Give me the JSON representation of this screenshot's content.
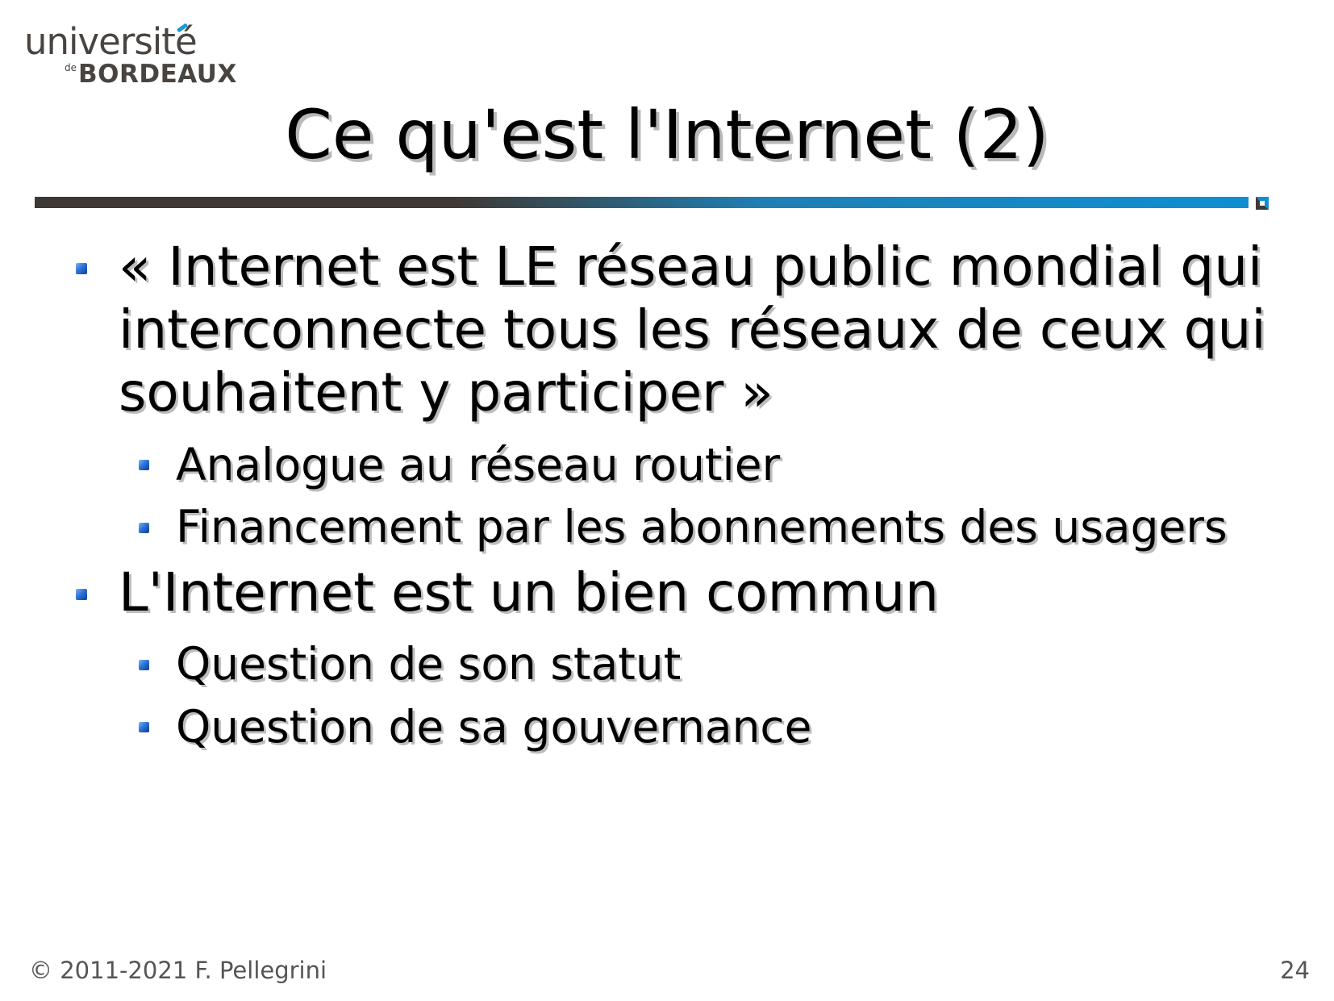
{
  "logo": {
    "line1": "université",
    "line2_small": "de",
    "line2_big": "BORDEAUX"
  },
  "slide": {
    "title": "Ce qu'est l'Internet (2)",
    "bullets": [
      {
        "lines": [
          "« Internet est LE réseau public mondial qui",
          "interconnecte tous les réseaux de ceux qui",
          "souhaitent y participer »"
        ],
        "sub": [
          "Analogue au réseau routier",
          "Financement par les abonnements des usagers"
        ]
      },
      {
        "lines": [
          "L'Internet est un bien commun"
        ],
        "sub": [
          "Question de son statut",
          "Question de sa gouvernance"
        ]
      }
    ]
  },
  "footer": {
    "copyright": "© 2011-2021 F. Pellegrini",
    "page_number": "24"
  }
}
